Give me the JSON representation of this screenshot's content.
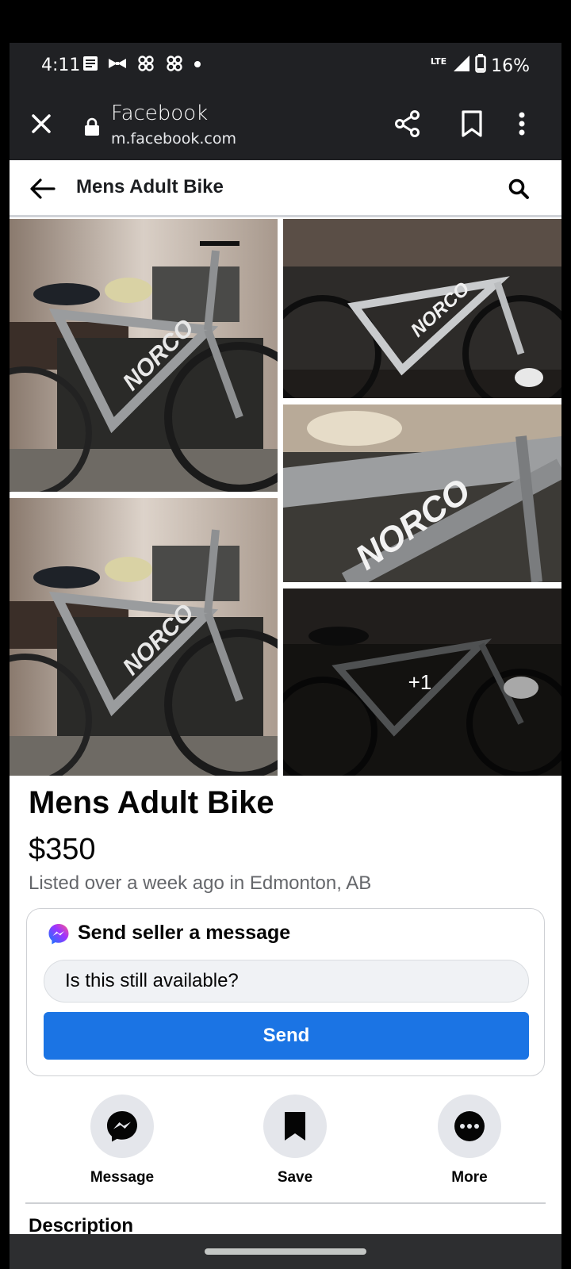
{
  "status_bar": {
    "time": "4:11",
    "network": "LTE",
    "battery": "16%",
    "notification_icons": [
      "notes-icon",
      "bow-tie-icon",
      "pinwheel-icon",
      "pinwheel-icon",
      "dot-icon"
    ]
  },
  "browser": {
    "page_title": "Facebook",
    "url": "m.facebook.com"
  },
  "header": {
    "title": "Mens Adult Bike"
  },
  "photos": {
    "extra_count": "+1",
    "frame_text": "NORCO"
  },
  "listing": {
    "title": "Mens Adult Bike",
    "price": "$350",
    "meta": "Listed over a week ago in Edmonton, AB"
  },
  "message_card": {
    "title": "Send seller a message",
    "input_value": "Is this still available?",
    "send_label": "Send"
  },
  "actions": [
    {
      "label": "Message",
      "icon": "messenger-icon"
    },
    {
      "label": "Save",
      "icon": "bookmark-icon"
    },
    {
      "label": "More",
      "icon": "more-icon"
    }
  ],
  "description_heading": "Description",
  "colors": {
    "brand_blue": "#1b74e4",
    "chrome_bg": "#202124",
    "secondary_text": "#65676b",
    "button_gray": "#e4e6eb"
  }
}
